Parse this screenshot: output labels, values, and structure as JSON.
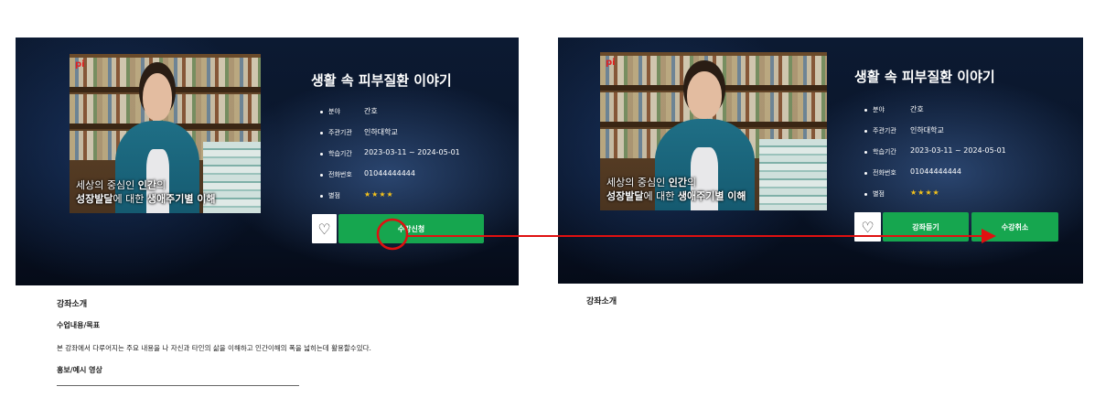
{
  "left_screen": {
    "course": {
      "title": "생활 속 피부질환 이야기",
      "thumbnail": {
        "logo": "pi",
        "caption_line1_pre": "세상의 중심인 ",
        "caption_line1_bold": "인간",
        "caption_line1_post": "의",
        "caption_line2_pre": "성장발달",
        "caption_line2_mid": "에 대한 ",
        "caption_line2_bold": "생애주기별 이해"
      },
      "info": [
        {
          "label": "분야",
          "value": "간호"
        },
        {
          "label": "주관기관",
          "value": "인하대학교"
        },
        {
          "label": "학습기간",
          "value": "2023-03-11 ~ 2024-05-01"
        },
        {
          "label": "전화번호",
          "value": "01044444444"
        },
        {
          "label": "별점",
          "value": "★★★★",
          "rating": 4
        }
      ],
      "heart_icon": "heart-outline-icon",
      "heart_glyph": "♡",
      "apply_button": "수강신청"
    },
    "below": {
      "section_title": "강좌소개",
      "subtitle": "수업내용/목표",
      "description": "본 강좌에서 다루어지는 주요 내용을 나 자신과 타인의 삶을 이해하고 인간이해의 폭을 넓히는데 활용할수있다.",
      "video_heading": "홍보/예시 영상"
    }
  },
  "right_screen": {
    "course": {
      "title": "생활 속 피부질환 이야기",
      "thumbnail": {
        "logo": "pi",
        "caption_line1_pre": "세상의 중심인 ",
        "caption_line1_bold": "인간",
        "caption_line1_post": "의",
        "caption_line2_pre": "성장발달",
        "caption_line2_mid": "에 대한 ",
        "caption_line2_bold": "생애주기별 이해"
      },
      "info": [
        {
          "label": "분야",
          "value": "간호"
        },
        {
          "label": "주관기관",
          "value": "인하대학교"
        },
        {
          "label": "학습기간",
          "value": "2023-03-11 ~ 2024-05-01"
        },
        {
          "label": "전화번호",
          "value": "01044444444"
        },
        {
          "label": "별점",
          "value": "★★★★",
          "rating": 4
        }
      ],
      "heart_icon": "heart-outline-icon",
      "heart_glyph": "♡",
      "listen_button": "강좌듣기",
      "cancel_button": "수강취소"
    },
    "below": {
      "section_title": "강좌소개"
    }
  },
  "annotation": {
    "highlight_color": "#e01010",
    "arrow_color": "#e01010"
  },
  "colors": {
    "button_green": "#16a64f",
    "star_yellow": "#f4c21b",
    "panel_dark": "#0c1a32"
  }
}
